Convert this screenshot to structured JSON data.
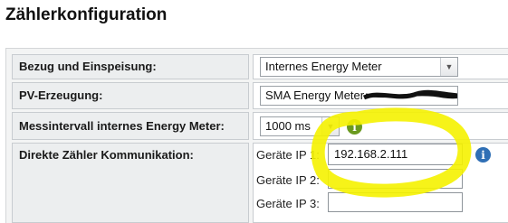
{
  "page": {
    "title": "Zählerkonfiguration"
  },
  "config": {
    "rows": [
      {
        "label": "Bezug und Einspeisung:",
        "value": "Internes Energy Meter"
      },
      {
        "label": "PV-Erzeugung:",
        "value": "SMA Energy Meter"
      },
      {
        "label": "Messintervall internes Energy Meter:",
        "value": "1000 ms"
      },
      {
        "label": "Direkte Zähler Kommunikation:"
      }
    ],
    "direct": {
      "ip1_label": "Geräte IP 1:",
      "ip1_value": "192.168.2.111",
      "ip2_label": "Geräte IP 2:",
      "ip2_value": "",
      "ip3_label": "Geräte IP 3:",
      "ip3_value": ""
    }
  },
  "icons": {
    "dropdown": "chevron-down-icon",
    "info_green": "info-icon",
    "info_blue": "info-icon"
  },
  "colors": {
    "info_green": "#6a9a1f",
    "info_blue": "#2f6fb5",
    "highlight": "#f5f200"
  }
}
